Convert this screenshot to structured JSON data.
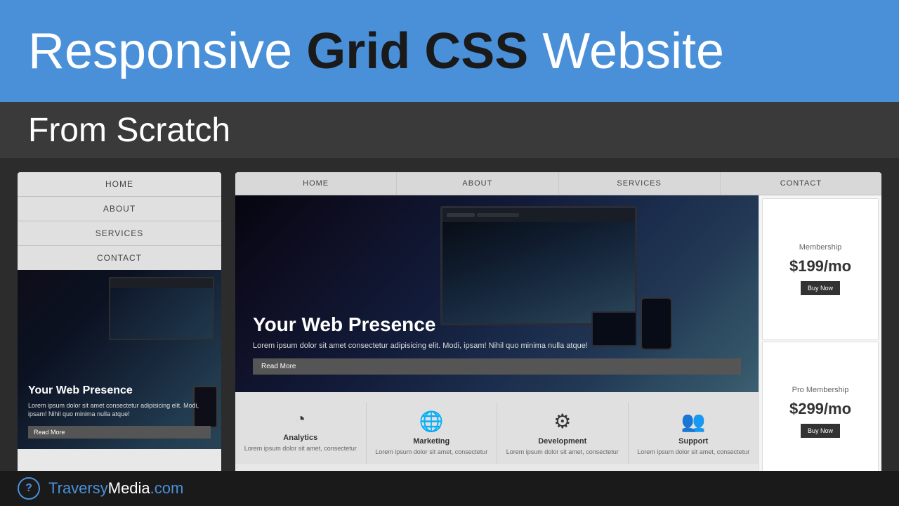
{
  "topBanner": {
    "titleStart": "Responsive ",
    "titleHighlight": "Grid CSS",
    "titleEnd": " Website"
  },
  "subBanner": {
    "title": "From Scratch"
  },
  "mobilePreview": {
    "nav": [
      "HOME",
      "ABOUT",
      "SERVICES",
      "CONTACT"
    ],
    "hero": {
      "title": "Your Web Presence",
      "text": "Lorem ipsum dolor sit amet consectetur adipisicing elit. Modi, ipsam! Nihil quo minima nulla atque!",
      "readMoreLabel": "Read More"
    }
  },
  "desktopPreview": {
    "nav": [
      "HOME",
      "ABOUT",
      "SERVICES",
      "CONTACT"
    ],
    "hero": {
      "title": "Your Web Presence",
      "text": "Lorem ipsum dolor sit amet consectetur adipisicing elit. Modi, ipsam! Nihil quo minima nulla atque!",
      "readMoreLabel": "Read More"
    },
    "services": [
      {
        "icon": "◔",
        "title": "Analytics",
        "text": "Lorem ipsum dolor sit amet, consectetur"
      },
      {
        "icon": "🌐",
        "title": "Marketing",
        "text": "Lorem ipsum dolor sit amet, consectetur"
      },
      {
        "icon": "⚙",
        "title": "Development",
        "text": "Lorem ipsum dolor sit amet, consectetur"
      },
      {
        "icon": "👥",
        "title": "Support",
        "text": "Lorem ipsum dolor sit amet, consectetur"
      }
    ],
    "sidebar": [
      {
        "title": "Membership",
        "price": "$199/mo",
        "buttonLabel": "Buy Now"
      },
      {
        "title": "Pro Membership",
        "price": "$299/mo",
        "buttonLabel": "Buy Now"
      }
    ]
  },
  "bottomBar": {
    "logoSymbol": "?",
    "logoTextBlue": "Traversy",
    "logoTextWhite": "Media",
    "logoDomain": ".com"
  }
}
